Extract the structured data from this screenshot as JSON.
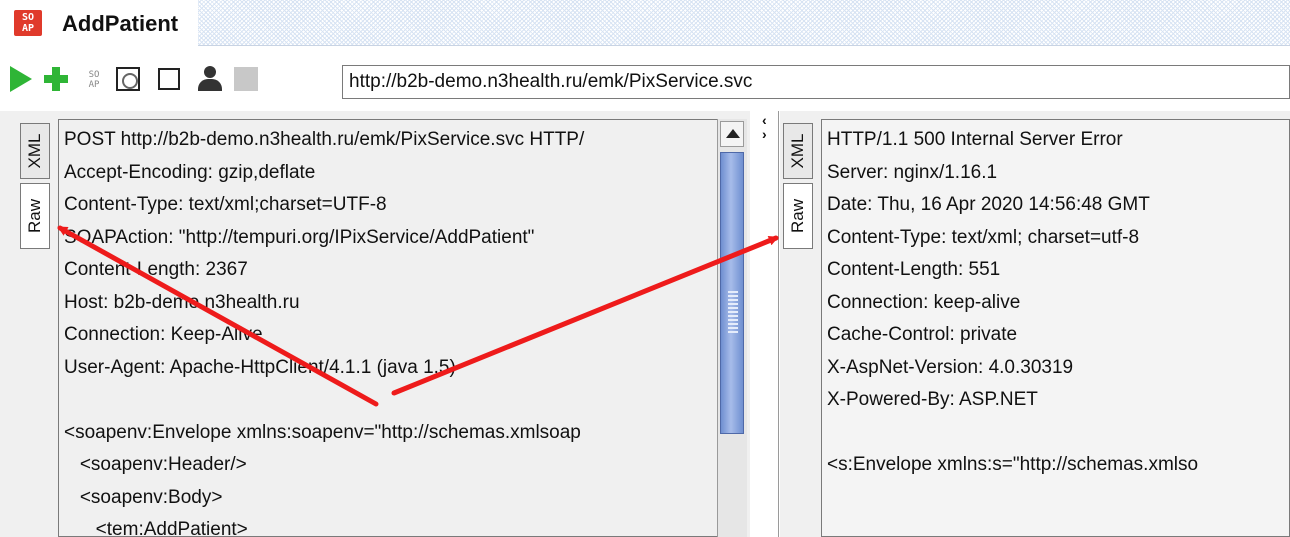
{
  "window": {
    "logo_text_top": "SO",
    "logo_text_bottom": "AP",
    "title": "AddPatient"
  },
  "toolbar": {
    "icons": [
      "run-icon",
      "add-icon",
      "soap-small-icon",
      "compress-icon",
      "square-icon",
      "user-icon",
      "stop-icon"
    ],
    "endpoint_url": "http://b2b-demo.n3health.ru/emk/PixService.svc"
  },
  "request": {
    "tabs": [
      "XML",
      "Raw"
    ],
    "active_tab": "Raw",
    "lines": [
      "POST http://b2b-demo.n3health.ru/emk/PixService.svc HTTP/",
      "Accept-Encoding: gzip,deflate",
      "Content-Type: text/xml;charset=UTF-8",
      "SOAPAction: \"http://tempuri.org/IPixService/AddPatient\"",
      "Content-Length: 2367",
      "Host: b2b-demo.n3health.ru",
      "Connection: Keep-Alive",
      "User-Agent: Apache-HttpClient/4.1.1 (java 1.5)",
      "",
      "<soapenv:Envelope xmlns:soapenv=\"http://schemas.xmlsoap",
      "   <soapenv:Header/>",
      "   <soapenv:Body>",
      "      <tem:AddPatient>"
    ]
  },
  "response": {
    "tabs": [
      "XML",
      "Raw"
    ],
    "active_tab": "Raw",
    "lines": [
      "HTTP/1.1 500 Internal Server Error",
      "Server: nginx/1.16.1",
      "Date: Thu, 16 Apr 2020 14:56:48 GMT",
      "Content-Type: text/xml; charset=utf-8",
      "Content-Length: 551",
      "Connection: keep-alive",
      "Cache-Control: private",
      "X-AspNet-Version: 4.0.30319",
      "X-Powered-By: ASP.NET",
      "",
      "<s:Envelope xmlns:s=\"http://schemas.xmlso"
    ]
  },
  "colors": {
    "accent_green": "#2fb536",
    "logo_red": "#e03a2b",
    "annotation_red": "#ee1b1b",
    "scroll_thumb": "#6f8fd0"
  }
}
